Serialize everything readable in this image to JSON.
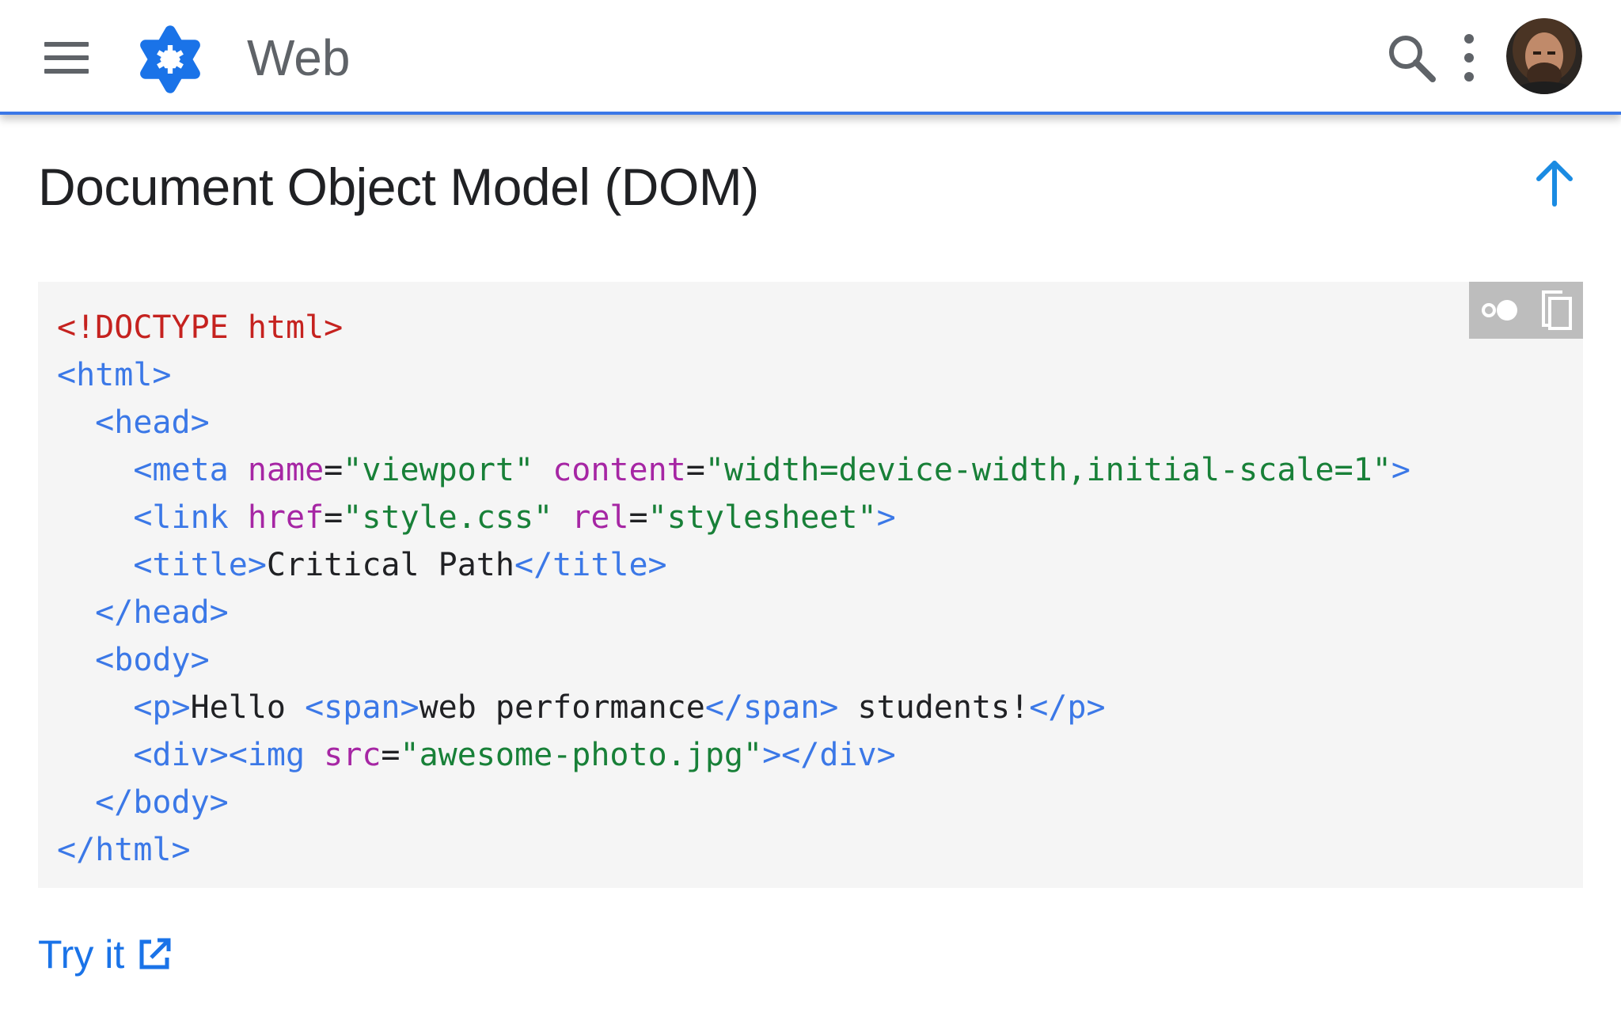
{
  "header": {
    "site_title": "Web",
    "menu_icon": "hamburger-menu-icon",
    "logo_icon": "asterisk-logo-icon",
    "search_icon": "search-icon",
    "more_icon": "more-vert-icon",
    "accent_color": "#3b78e7"
  },
  "section": {
    "title": "Document Object Model (DOM)",
    "back_to_top_icon": "arrow-upward-icon"
  },
  "code": {
    "toolbar_icons": [
      "dark-theme-toggle-icon",
      "copy-icon"
    ],
    "lines": [
      [
        {
          "cls": "c-doctype",
          "t": "<!DOCTYPE html>"
        }
      ],
      [
        {
          "cls": "c-tag",
          "t": "<html>"
        }
      ],
      [
        {
          "cls": "c-text",
          "t": "  "
        },
        {
          "cls": "c-tag",
          "t": "<head>"
        }
      ],
      [
        {
          "cls": "c-text",
          "t": "    "
        },
        {
          "cls": "c-tag",
          "t": "<meta"
        },
        {
          "cls": "c-text",
          "t": " "
        },
        {
          "cls": "c-attr",
          "t": "name"
        },
        {
          "cls": "c-text",
          "t": "="
        },
        {
          "cls": "c-val",
          "t": "\"viewport\""
        },
        {
          "cls": "c-text",
          "t": " "
        },
        {
          "cls": "c-attr",
          "t": "content"
        },
        {
          "cls": "c-text",
          "t": "="
        },
        {
          "cls": "c-val",
          "t": "\"width=device-width,initial-scale=1\""
        },
        {
          "cls": "c-tag",
          "t": ">"
        }
      ],
      [
        {
          "cls": "c-text",
          "t": "    "
        },
        {
          "cls": "c-tag",
          "t": "<link"
        },
        {
          "cls": "c-text",
          "t": " "
        },
        {
          "cls": "c-attr",
          "t": "href"
        },
        {
          "cls": "c-text",
          "t": "="
        },
        {
          "cls": "c-val",
          "t": "\"style.css\""
        },
        {
          "cls": "c-text",
          "t": " "
        },
        {
          "cls": "c-attr",
          "t": "rel"
        },
        {
          "cls": "c-text",
          "t": "="
        },
        {
          "cls": "c-val",
          "t": "\"stylesheet\""
        },
        {
          "cls": "c-tag",
          "t": ">"
        }
      ],
      [
        {
          "cls": "c-text",
          "t": "    "
        },
        {
          "cls": "c-tag",
          "t": "<title>"
        },
        {
          "cls": "c-text",
          "t": "Critical Path"
        },
        {
          "cls": "c-tag",
          "t": "</title>"
        }
      ],
      [
        {
          "cls": "c-text",
          "t": "  "
        },
        {
          "cls": "c-tag",
          "t": "</head>"
        }
      ],
      [
        {
          "cls": "c-text",
          "t": "  "
        },
        {
          "cls": "c-tag",
          "t": "<body>"
        }
      ],
      [
        {
          "cls": "c-text",
          "t": "    "
        },
        {
          "cls": "c-tag",
          "t": "<p>"
        },
        {
          "cls": "c-text",
          "t": "Hello "
        },
        {
          "cls": "c-tag",
          "t": "<span>"
        },
        {
          "cls": "c-text",
          "t": "web performance"
        },
        {
          "cls": "c-tag",
          "t": "</span>"
        },
        {
          "cls": "c-text",
          "t": " students!"
        },
        {
          "cls": "c-tag",
          "t": "</p>"
        }
      ],
      [
        {
          "cls": "c-text",
          "t": "    "
        },
        {
          "cls": "c-tag",
          "t": "<div><img"
        },
        {
          "cls": "c-text",
          "t": " "
        },
        {
          "cls": "c-attr",
          "t": "src"
        },
        {
          "cls": "c-text",
          "t": "="
        },
        {
          "cls": "c-val",
          "t": "\"awesome-photo.jpg\""
        },
        {
          "cls": "c-tag",
          "t": "></div>"
        }
      ],
      [
        {
          "cls": "c-text",
          "t": "  "
        },
        {
          "cls": "c-tag",
          "t": "</body>"
        }
      ],
      [
        {
          "cls": "c-tag",
          "t": "</html>"
        }
      ]
    ]
  },
  "footer_link": {
    "label": "Try it",
    "icon": "open-in-new-icon"
  }
}
